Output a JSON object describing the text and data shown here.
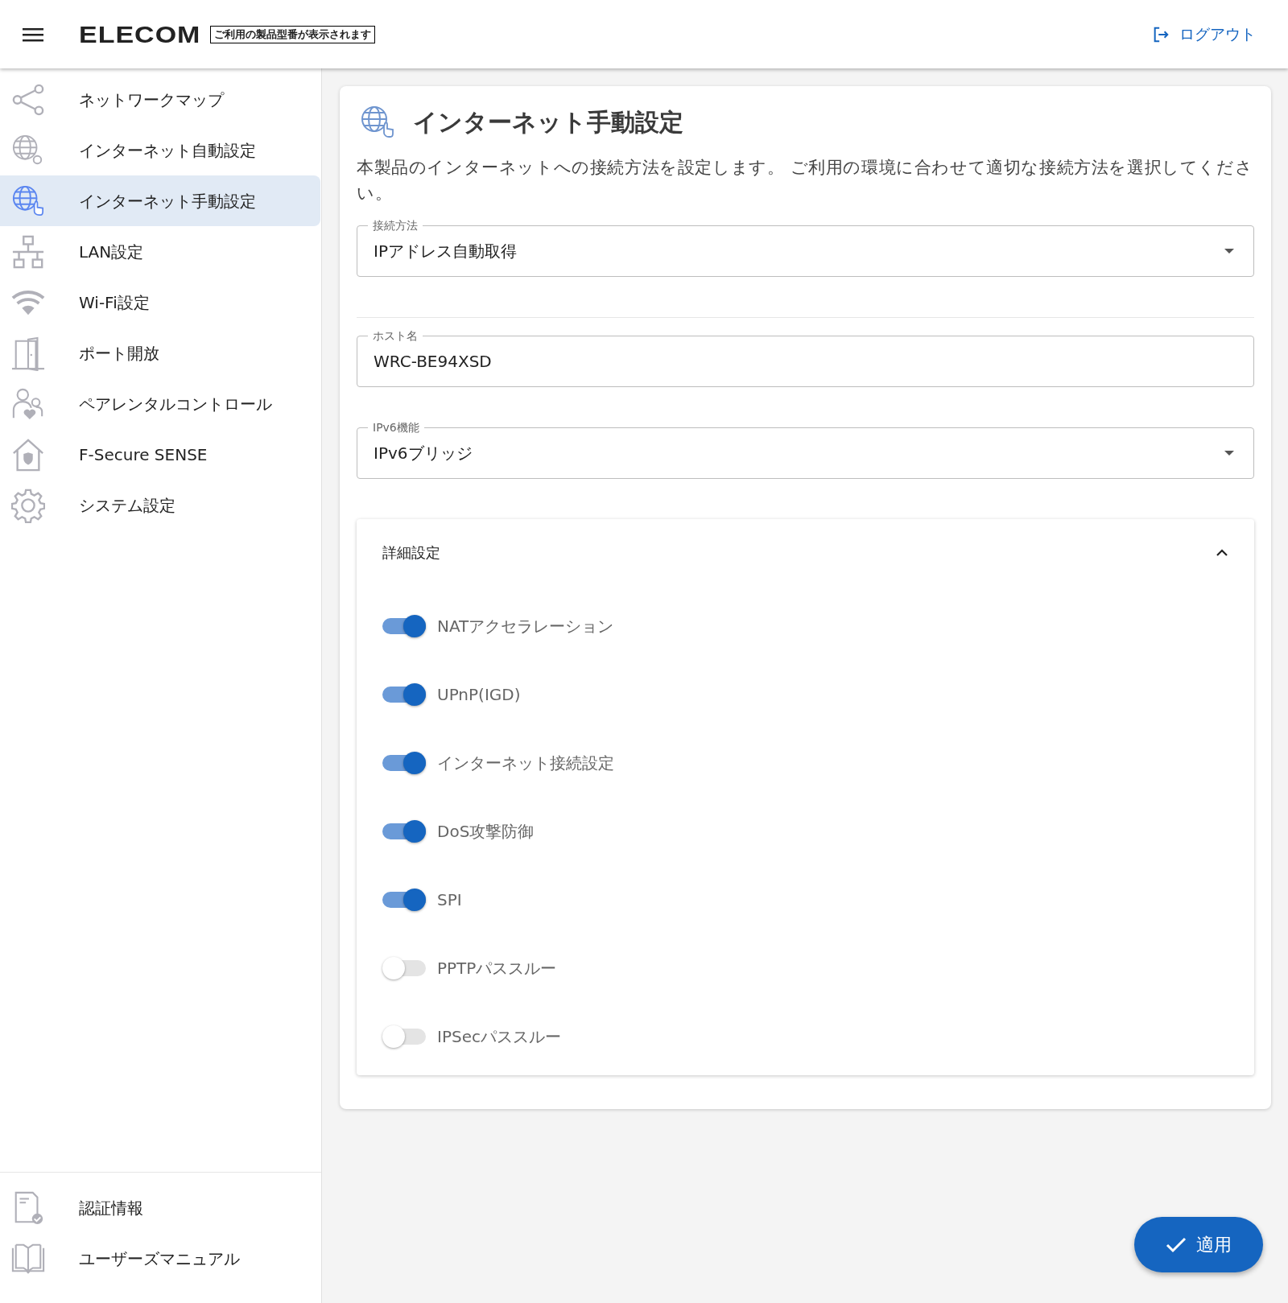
{
  "header": {
    "logo": "ELECOM",
    "model_badge": "ご利用の製品型番が表示されます",
    "logout": "ログアウト"
  },
  "sidebar": {
    "items": [
      {
        "label": "ネットワークマップ",
        "selected": false
      },
      {
        "label": "インターネット自動設定",
        "selected": false
      },
      {
        "label": "インターネット手動設定",
        "selected": true
      },
      {
        "label": "LAN設定",
        "selected": false
      },
      {
        "label": "Wi-Fi設定",
        "selected": false
      },
      {
        "label": "ポート開放",
        "selected": false
      },
      {
        "label": "ペアレンタルコントロール",
        "selected": false
      },
      {
        "label": "F-Secure SENSE",
        "selected": false
      },
      {
        "label": "システム設定",
        "selected": false
      }
    ],
    "footer_items": [
      {
        "label": "認証情報"
      },
      {
        "label": "ユーザーズマニュアル"
      }
    ]
  },
  "page": {
    "title": "インターネット手動設定",
    "description": "本製品のインターネットへの接続方法を設定します。 ご利用の環境に合わせて適切な接続方法を選択してください。",
    "fields": [
      {
        "kind": "select",
        "label": "接続方法",
        "value": "IPアドレス自動取得"
      },
      {
        "kind": "divider"
      },
      {
        "kind": "text",
        "label": "ホスト名",
        "value": "WRC-BE94XSD"
      },
      {
        "kind": "select",
        "label": "IPv6機能",
        "value": "IPv6ブリッジ"
      }
    ],
    "advanced": {
      "title": "詳細設定",
      "expanded": true,
      "toggles": [
        {
          "label": "NATアクセラレーション",
          "on": true
        },
        {
          "label": "UPnP(IGD)",
          "on": true
        },
        {
          "label": "インターネット接続設定",
          "on": true
        },
        {
          "label": "DoS攻撃防御",
          "on": true
        },
        {
          "label": "SPI",
          "on": true
        },
        {
          "label": "PPTPパススルー",
          "on": false
        },
        {
          "label": "IPSecパススルー",
          "on": false
        }
      ]
    }
  },
  "apply_button": "適用"
}
